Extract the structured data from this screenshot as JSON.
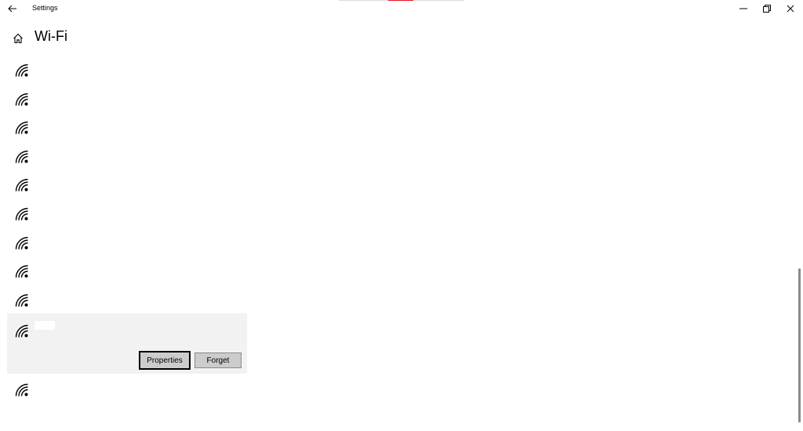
{
  "window": {
    "title": "Settings",
    "controls": {
      "minimize_icon": "minimize-icon",
      "maximize_icon": "restore-icon",
      "close_icon": "close-icon"
    }
  },
  "header": {
    "home_icon": "home-icon",
    "title": "Wi-Fi"
  },
  "networks": {
    "items": [
      {
        "icon": "wifi-signal-icon"
      },
      {
        "icon": "wifi-signal-icon"
      },
      {
        "icon": "wifi-signal-icon"
      },
      {
        "icon": "wifi-signal-icon"
      },
      {
        "icon": "wifi-signal-icon"
      },
      {
        "icon": "wifi-signal-icon"
      },
      {
        "icon": "wifi-signal-icon"
      },
      {
        "icon": "wifi-signal-icon"
      },
      {
        "icon": "wifi-signal-icon"
      },
      {
        "icon": "wifi-signal-icon",
        "selected": true
      },
      {
        "icon": "wifi-signal-icon"
      }
    ],
    "selected_actions": {
      "properties_label": "Properties",
      "forget_label": "Forget"
    }
  },
  "colors": {
    "accent_red": "#e81123",
    "selected_background": "#f2f2f2",
    "button_background": "#cccccc"
  }
}
